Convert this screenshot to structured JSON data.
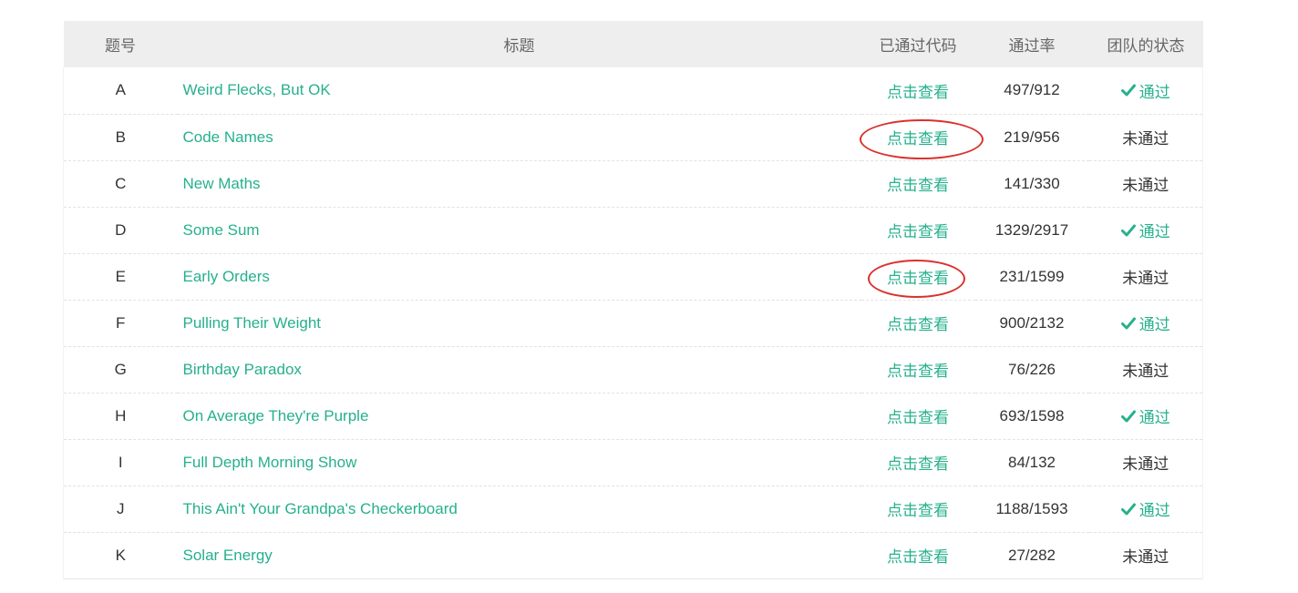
{
  "table": {
    "headers": {
      "id": "题号",
      "title": "标题",
      "code": "已通过代码",
      "rate": "通过率",
      "status": "团队的状态"
    },
    "rows": [
      {
        "id": "A",
        "title": "Weird Flecks, But OK",
        "code": "点击查看",
        "rate": "497/912",
        "status": "通过",
        "passed": true
      },
      {
        "id": "B",
        "title": "Code Names",
        "code": "点击查看",
        "rate": "219/956",
        "status": "未通过",
        "passed": false
      },
      {
        "id": "C",
        "title": "New Maths",
        "code": "点击查看",
        "rate": "141/330",
        "status": "未通过",
        "passed": false
      },
      {
        "id": "D",
        "title": "Some Sum",
        "code": "点击查看",
        "rate": "1329/2917",
        "status": "通过",
        "passed": true
      },
      {
        "id": "E",
        "title": "Early Orders",
        "code": "点击查看",
        "rate": "231/1599",
        "status": "未通过",
        "passed": false
      },
      {
        "id": "F",
        "title": "Pulling Their Weight",
        "code": "点击查看",
        "rate": "900/2132",
        "status": "通过",
        "passed": true
      },
      {
        "id": "G",
        "title": "Birthday Paradox",
        "code": "点击查看",
        "rate": "76/226",
        "status": "未通过",
        "passed": false
      },
      {
        "id": "H",
        "title": "On Average They're Purple",
        "code": "点击查看",
        "rate": "693/1598",
        "status": "通过",
        "passed": true
      },
      {
        "id": "I",
        "title": "Full Depth Morning Show",
        "code": "点击查看",
        "rate": "84/132",
        "status": "未通过",
        "passed": false
      },
      {
        "id": "J",
        "title": "This Ain't Your Grandpa's Checkerboard",
        "code": "点击查看",
        "rate": "1188/1593",
        "status": "通过",
        "passed": true
      },
      {
        "id": "K",
        "title": "Solar Energy",
        "code": "点击查看",
        "rate": "27/282",
        "status": "未通过",
        "passed": false
      }
    ]
  },
  "colors": {
    "accent": "#26b08d",
    "header_bg": "#eeeeee",
    "annotation": "#d9322e"
  }
}
